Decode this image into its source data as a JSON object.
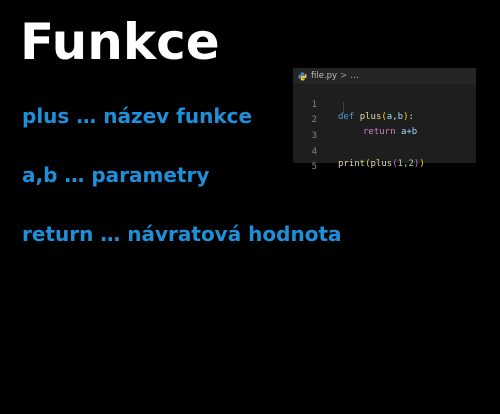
{
  "slide": {
    "title": "Funkce",
    "lines": [
      "plus … název funkce",
      "a,b … parametry",
      "return … návratová hodnota"
    ]
  },
  "editor": {
    "breadcrumb": {
      "file": "file.py",
      "separator": ">",
      "more": "…"
    },
    "line_numbers": [
      "1",
      "2",
      "3",
      "4",
      "5"
    ],
    "code": {
      "l1_def": "def",
      "l1_name": "plus",
      "l1_open": "(",
      "l1_a": "a",
      "l1_comma": ",",
      "l1_b": "b",
      "l1_close": ")",
      "l1_colon": ":",
      "l2_return": "return",
      "l2_expr": "a+b",
      "l4_print": "print",
      "l4_open1": "(",
      "l4_plus": "plus",
      "l4_open2": "(",
      "l4_args": "1,2",
      "l4_close2": ")",
      "l4_close1": ")"
    }
  },
  "colors": {
    "background": "#000000",
    "title": "#ffffff",
    "text_accent": "#1e8fd9",
    "editor_bg": "#1e1e1e"
  }
}
